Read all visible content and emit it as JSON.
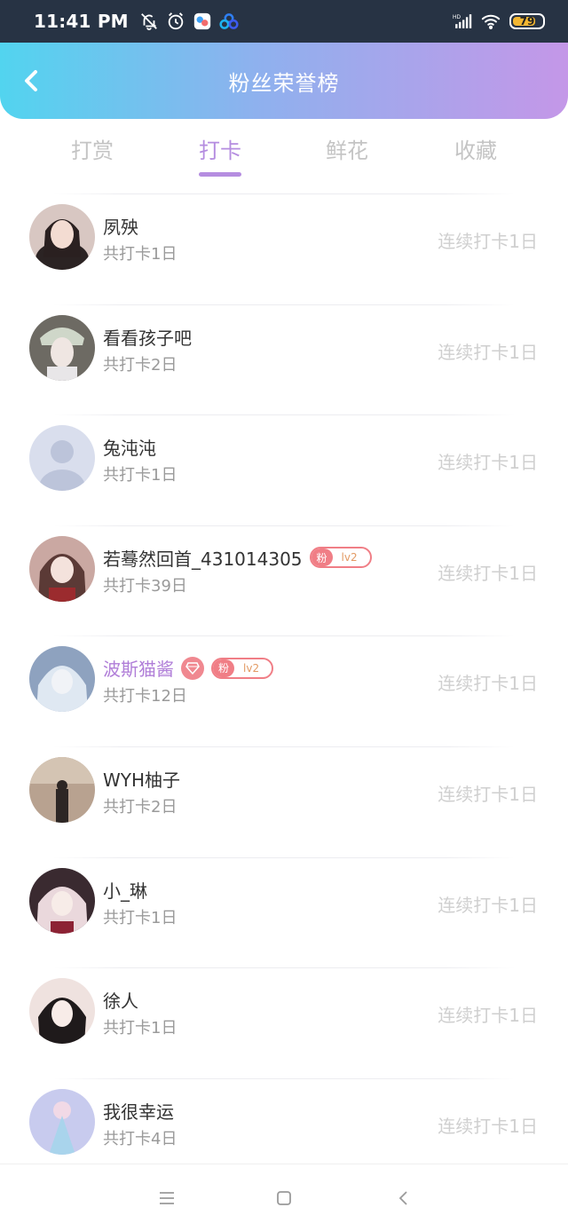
{
  "status_bar": {
    "time": "11:41 PM",
    "battery": "79",
    "icons_left": [
      "mute-bell-icon",
      "alarm-icon",
      "gallery-app-icon",
      "cloud-app-icon"
    ],
    "icons_right": [
      "hd-signal-icon",
      "wifi-icon",
      "battery-icon"
    ]
  },
  "header": {
    "title": "粉丝荣誉榜",
    "back_icon": "chevron-left-icon"
  },
  "tabs": [
    {
      "label": "打赏",
      "active": false
    },
    {
      "label": "打卡",
      "active": true
    },
    {
      "label": "鲜花",
      "active": false
    },
    {
      "label": "收藏",
      "active": false
    }
  ],
  "colors": {
    "accent": "#b58de0",
    "header_gradient_start": "#52d4ef",
    "header_gradient_end": "#c497e8",
    "badge": "#f07e86"
  },
  "fans": [
    {
      "name": "夙殃",
      "total": "共打卡1日",
      "streak": "连续打卡1日",
      "badge": null,
      "vip": false
    },
    {
      "name": "看看孩子吧",
      "total": "共打卡2日",
      "streak": "连续打卡1日",
      "badge": null,
      "vip": false
    },
    {
      "name": "兔沌沌",
      "total": "共打卡1日",
      "streak": "连续打卡1日",
      "badge": null,
      "vip": false
    },
    {
      "name": "若蓦然回首_431014305",
      "total": "共打卡39日",
      "streak": "连续打卡1日",
      "badge": {
        "left": "粉",
        "right": "lv2"
      },
      "vip": false
    },
    {
      "name": "波斯猫酱",
      "total": "共打卡12日",
      "streak": "连续打卡1日",
      "badge": {
        "left": "粉",
        "right": "lv2"
      },
      "vip": true
    },
    {
      "name": "WYH柚子",
      "total": "共打卡2日",
      "streak": "连续打卡1日",
      "badge": null,
      "vip": false
    },
    {
      "name": "小_琳",
      "total": "共打卡1日",
      "streak": "连续打卡1日",
      "badge": null,
      "vip": false
    },
    {
      "name": "徐人",
      "total": "共打卡1日",
      "streak": "连续打卡1日",
      "badge": null,
      "vip": false
    },
    {
      "name": "我很幸运",
      "total": "共打卡4日",
      "streak": "连续打卡1日",
      "badge": null,
      "vip": false
    }
  ],
  "nav_bar": {
    "buttons": [
      "menu-icon",
      "home-square-icon",
      "back-triangle-icon"
    ]
  }
}
